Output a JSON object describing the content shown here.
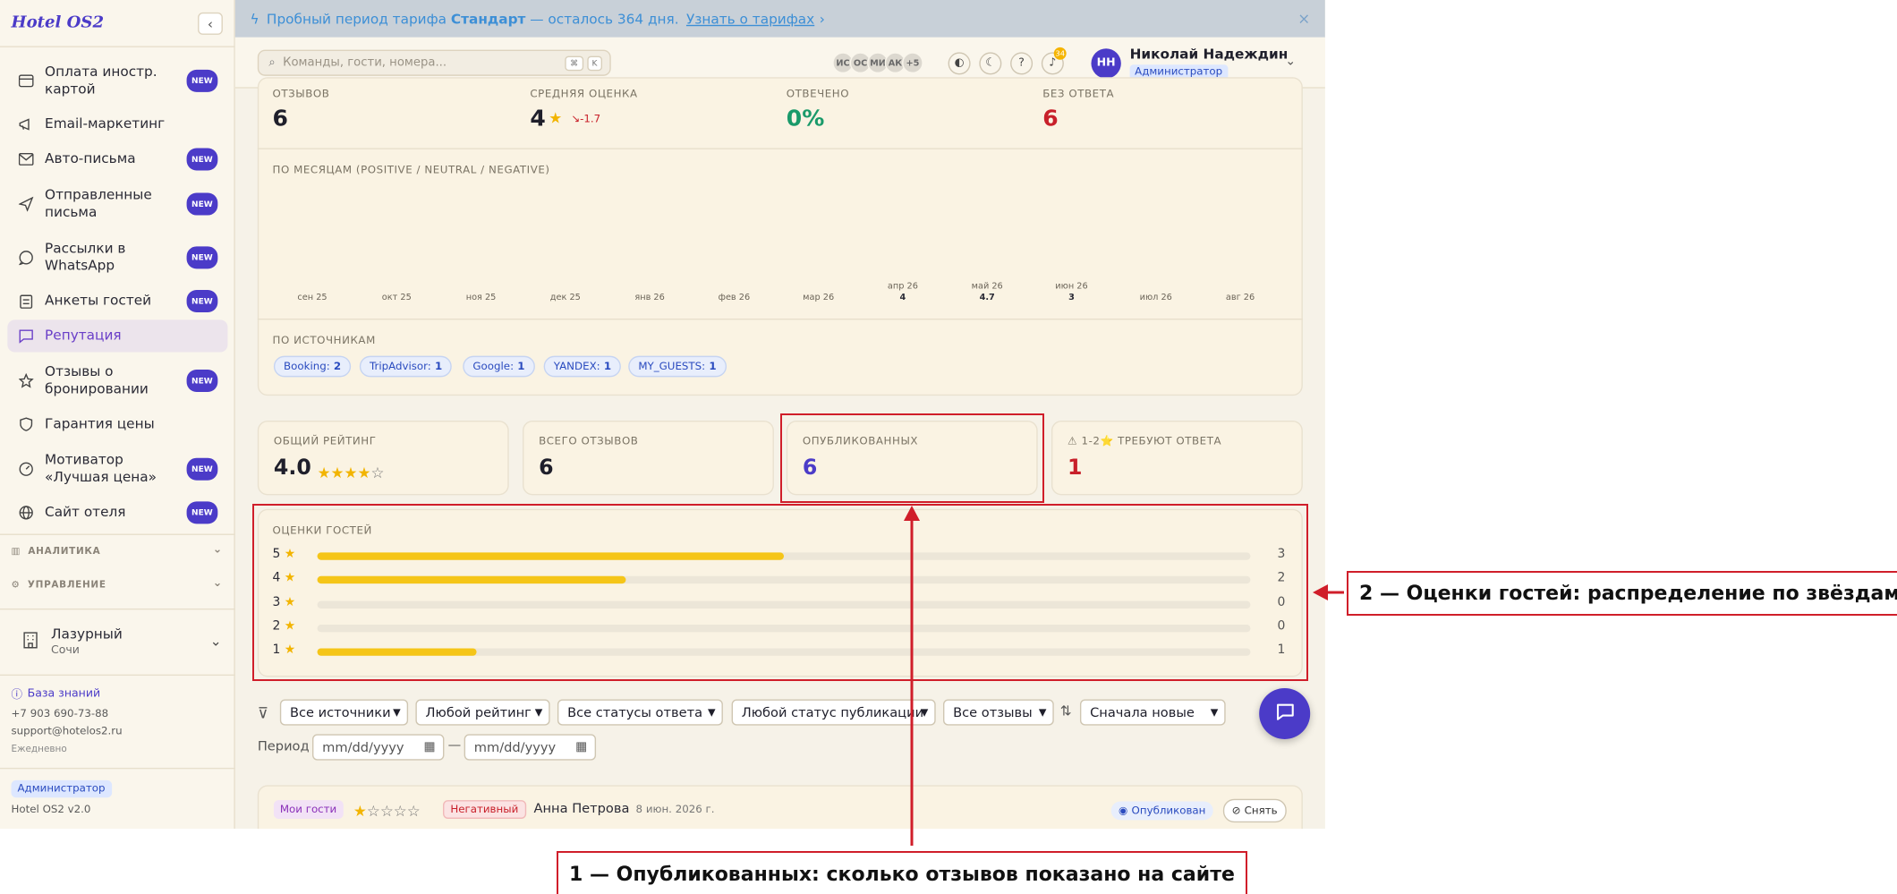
{
  "brand": "Hotel OS2",
  "sidebar": {
    "items": [
      {
        "label": "Оплата иностр. картой",
        "badge": "NEW"
      },
      {
        "label": "Email-маркетинг",
        "badge": ""
      },
      {
        "label": "Авто-письма",
        "badge": "NEW"
      },
      {
        "label": "Отправленные письма",
        "badge": "NEW"
      },
      {
        "label": "Рассылки в WhatsApp",
        "badge": "NEW"
      },
      {
        "label": "Анкеты гостей",
        "badge": "NEW"
      },
      {
        "label": "Репутация",
        "badge": ""
      },
      {
        "label": "Отзывы о бронировании",
        "badge": "NEW"
      },
      {
        "label": "Гарантия цены",
        "badge": ""
      },
      {
        "label": "Мотиватор «Лучшая цена»",
        "badge": "NEW"
      },
      {
        "label": "Сайт отеля",
        "badge": "NEW"
      }
    ],
    "sections": [
      "АНАЛИТИКА",
      "УПРАВЛЕНИЕ"
    ],
    "hotel": {
      "name": "Лазурный",
      "city": "Сочи"
    },
    "knowledge_base": "База знаний",
    "phone": "+7 903 690-73-88",
    "email": "support@hotelos2.ru",
    "schedule": "Ежедневно",
    "role": "Администратор",
    "version": "Hotel OS2 v2.0"
  },
  "banner": {
    "prefix": "Пробный период тарифа",
    "plan": "Стандарт",
    "suffix": "— осталось 364 дня.",
    "link": "Узнать о тарифах",
    "close": "×"
  },
  "header": {
    "search_placeholder": "Команды, гости, номера...",
    "kbd": [
      "⌘",
      "K"
    ],
    "avatars": [
      "ИС",
      "ОС",
      "МИ",
      "АК",
      "+5"
    ],
    "notif_count": "34",
    "user_initials": "НН",
    "user_name": "Николай Надеждин",
    "user_role": "Администратор"
  },
  "summary": {
    "reviews_label": "ОТЗЫВОВ",
    "reviews_value": "6",
    "avg_label": "СРЕДНЯЯ ОЦЕНКА",
    "avg_value": "4",
    "avg_delta": "↘-1.7",
    "answered_label": "ОТВЕЧЕНО",
    "answered_value": "0%",
    "unanswered_label": "БЕЗ ОТВЕТА",
    "unanswered_value": "6"
  },
  "monthly": {
    "title": "ПО МЕСЯЦАМ (POSITIVE / NEUTRAL / NEGATIVE)",
    "months": [
      {
        "label": "сен 25",
        "value": ""
      },
      {
        "label": "окт 25",
        "value": ""
      },
      {
        "label": "ноя 25",
        "value": ""
      },
      {
        "label": "дек 25",
        "value": ""
      },
      {
        "label": "янв 26",
        "value": ""
      },
      {
        "label": "фев 26",
        "value": ""
      },
      {
        "label": "мар 26",
        "value": ""
      },
      {
        "label": "апр 26",
        "value": "4"
      },
      {
        "label": "май 26",
        "value": "4.7"
      },
      {
        "label": "июн 26",
        "value": "3"
      },
      {
        "label": "июл 26",
        "value": ""
      },
      {
        "label": "авг 26",
        "value": ""
      }
    ]
  },
  "sources": {
    "title": "ПО ИСТОЧНИКАМ",
    "items": [
      {
        "name": "Booking:",
        "count": "2"
      },
      {
        "name": "TripAdvisor:",
        "count": "1"
      },
      {
        "name": "Google:",
        "count": "1"
      },
      {
        "name": "YANDEX:",
        "count": "1"
      },
      {
        "name": "MY_GUESTS:",
        "count": "1"
      }
    ]
  },
  "stats": {
    "overall_label": "ОБЩИЙ РЕЙТИНГ",
    "overall_value": "4.0",
    "overall_stars": 4,
    "total_label": "ВСЕГО ОТЗЫВОВ",
    "total_value": "6",
    "published_label": "ОПУБЛИКОВАННЫХ",
    "published_value": "6",
    "needs_reply_label": "⚠ 1-2⭐ ТРЕБУЮТ ОТВЕТА",
    "needs_reply_value": "1"
  },
  "chart_data": {
    "type": "bar",
    "title": "ОЦЕНКИ ГОСТЕЙ",
    "categories": [
      "5",
      "4",
      "3",
      "2",
      "1"
    ],
    "values": [
      3,
      2,
      0,
      0,
      1
    ],
    "fill_fraction": [
      0.5,
      0.33,
      0,
      0,
      0.17
    ]
  },
  "filters": {
    "selects": [
      "Все источники",
      "Любой рейтинг",
      "Все статусы ответа",
      "Любой статус публикации",
      "Все отзывы"
    ],
    "sort": "Сначала новые",
    "period_label": "Период",
    "date_placeholder": "mm/dd/yyyy",
    "dash": "—"
  },
  "review": {
    "source": "Мои гости",
    "stars": 1,
    "sentiment": "Негативный",
    "author": "Анна Петрова",
    "date": "8 июн. 2026 г.",
    "status": "Опубликован",
    "action": "Снять"
  },
  "annotations": {
    "one": "1 — Опубликованных: сколько отзывов показано на сайте",
    "two": "2 — Оценки гостей: распределение по звёздам"
  },
  "colors": {
    "accent": "#4b3bc8",
    "annotation": "#d01e2a",
    "bar": "#f5c518"
  }
}
